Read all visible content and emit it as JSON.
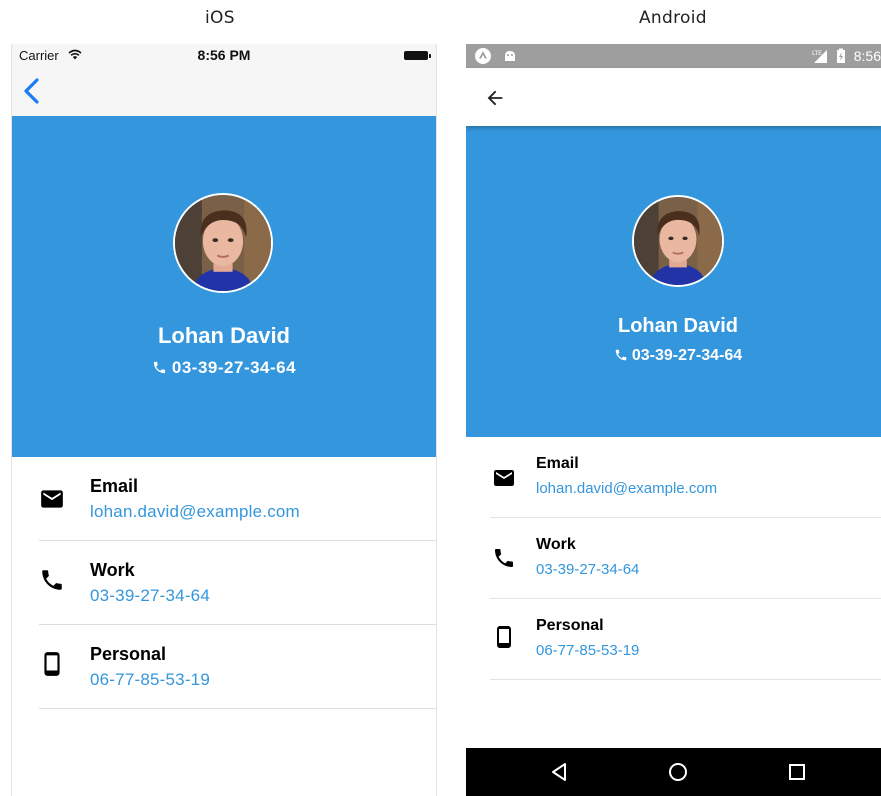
{
  "titles": {
    "ios": "iOS",
    "android": "Android"
  },
  "colors": {
    "accent": "#3496dc",
    "header_bg": "#3496dc",
    "value_text": "#3496dc",
    "android_nav_bar": "#000000",
    "android_status_bar": "#9e9e9e"
  },
  "ios": {
    "status_bar": {
      "carrier": "Carrier",
      "time": "8:56 PM",
      "icons": [
        "wifi-icon",
        "battery-icon"
      ]
    },
    "nav_bar": {
      "back_icon": "chevron-left-icon"
    },
    "profile": {
      "name": "Lohan David",
      "phone": "03-39-27-34-64",
      "avatar": "avatar-photo"
    },
    "details": [
      {
        "icon": "email-icon",
        "label": "Email",
        "value": "lohan.david@example.com"
      },
      {
        "icon": "phone-icon",
        "label": "Work",
        "value": "03-39-27-34-64"
      },
      {
        "icon": "smartphone-icon",
        "label": "Personal",
        "value": "06-77-85-53-19"
      }
    ]
  },
  "android": {
    "status_bar": {
      "time": "8:56",
      "icons": [
        "app-launcher-icon",
        "android-debug-icon",
        "lte-signal-icon",
        "battery-charging-icon"
      ]
    },
    "toolbar": {
      "back_icon": "arrow-back-icon"
    },
    "profile": {
      "name": "Lohan David",
      "phone": "03-39-27-34-64",
      "avatar": "avatar-photo"
    },
    "details": [
      {
        "icon": "email-icon",
        "label": "Email",
        "value": "lohan.david@example.com"
      },
      {
        "icon": "phone-icon",
        "label": "Work",
        "value": "03-39-27-34-64"
      },
      {
        "icon": "smartphone-icon",
        "label": "Personal",
        "value": "06-77-85-53-19"
      }
    ],
    "nav_bar": {
      "buttons": [
        "back-triangle-icon",
        "home-circle-icon",
        "recents-square-icon"
      ]
    }
  }
}
